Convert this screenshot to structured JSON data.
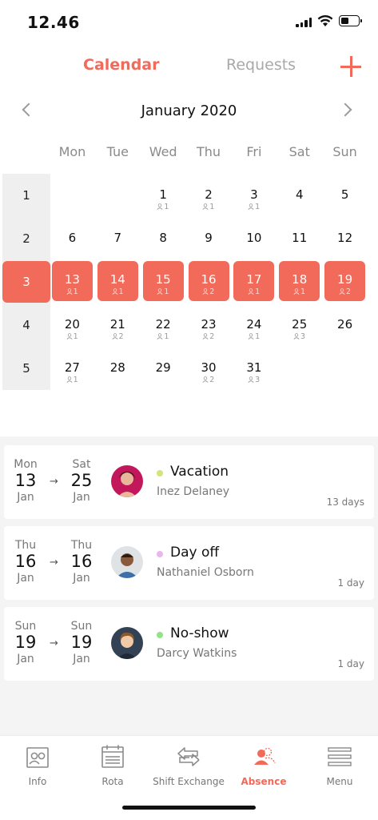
{
  "status": {
    "time": "12.46"
  },
  "header": {
    "tab_calendar": "Calendar",
    "tab_requests": "Requests",
    "add_icon": "plus-icon"
  },
  "calendar": {
    "month_title": "January 2020",
    "weekdays": [
      "Mon",
      "Tue",
      "Wed",
      "Thu",
      "Fri",
      "Sat",
      "Sun"
    ],
    "weeks": [
      {
        "week": "1",
        "days": [
          {
            "d": "",
            "c": ""
          },
          {
            "d": "",
            "c": ""
          },
          {
            "d": "1",
            "c": "1"
          },
          {
            "d": "2",
            "c": "1"
          },
          {
            "d": "3",
            "c": "1"
          },
          {
            "d": "4",
            "c": ""
          },
          {
            "d": "5",
            "c": ""
          }
        ]
      },
      {
        "week": "2",
        "days": [
          {
            "d": "6",
            "c": ""
          },
          {
            "d": "7",
            "c": ""
          },
          {
            "d": "8",
            "c": ""
          },
          {
            "d": "9",
            "c": ""
          },
          {
            "d": "10",
            "c": ""
          },
          {
            "d": "11",
            "c": ""
          },
          {
            "d": "12",
            "c": ""
          }
        ]
      },
      {
        "week": "3",
        "selected": true,
        "days": [
          {
            "d": "13",
            "c": "1"
          },
          {
            "d": "14",
            "c": "1"
          },
          {
            "d": "15",
            "c": "1"
          },
          {
            "d": "16",
            "c": "2"
          },
          {
            "d": "17",
            "c": "1"
          },
          {
            "d": "18",
            "c": "1"
          },
          {
            "d": "19",
            "c": "2"
          }
        ]
      },
      {
        "week": "4",
        "days": [
          {
            "d": "20",
            "c": "1"
          },
          {
            "d": "21",
            "c": "2"
          },
          {
            "d": "22",
            "c": "1"
          },
          {
            "d": "23",
            "c": "2"
          },
          {
            "d": "24",
            "c": "1"
          },
          {
            "d": "25",
            "c": "3"
          },
          {
            "d": "26",
            "c": ""
          }
        ]
      },
      {
        "week": "5",
        "days": [
          {
            "d": "27",
            "c": "1"
          },
          {
            "d": "28",
            "c": ""
          },
          {
            "d": "29",
            "c": ""
          },
          {
            "d": "30",
            "c": "2"
          },
          {
            "d": "31",
            "c": "3"
          },
          {
            "d": "",
            "c": ""
          },
          {
            "d": "",
            "c": ""
          }
        ]
      }
    ]
  },
  "absences": [
    {
      "from_wd": "Mon",
      "from_day": "13",
      "from_mo": "Jan",
      "to_wd": "Sat",
      "to_day": "25",
      "to_mo": "Jan",
      "type": "Vacation",
      "dot_color": "#d6e37a",
      "name": "Inez Delaney",
      "duration": "13 days"
    },
    {
      "from_wd": "Thu",
      "from_day": "16",
      "from_mo": "Jan",
      "to_wd": "Thu",
      "to_day": "16",
      "to_mo": "Jan",
      "type": "Day off",
      "dot_color": "#eab7ec",
      "name": "Nathaniel Osborn",
      "duration": "1 day"
    },
    {
      "from_wd": "Sun",
      "from_day": "19",
      "from_mo": "Jan",
      "to_wd": "Sun",
      "to_day": "19",
      "to_mo": "Jan",
      "type": "No-show",
      "dot_color": "#93e38b",
      "name": "Darcy Watkins",
      "duration": "1 day"
    }
  ],
  "nav": {
    "info": "Info",
    "rota": "Rota",
    "shift_exchange": "Shift Exchange",
    "absence": "Absence",
    "menu": "Menu"
  },
  "colors": {
    "accent": "#f26a5a"
  }
}
